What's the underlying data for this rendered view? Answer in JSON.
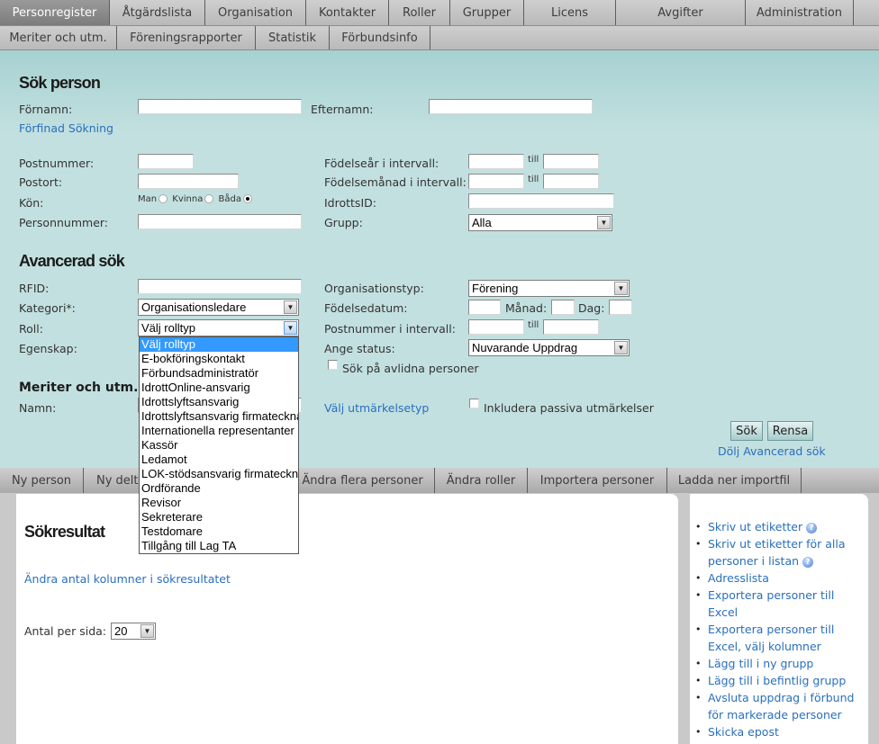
{
  "nav_primary": [
    {
      "label": "Personregister",
      "active": true
    },
    {
      "label": "Åtgärdslista"
    },
    {
      "label": "Organisation"
    },
    {
      "label": "Kontakter"
    },
    {
      "label": "Roller"
    },
    {
      "label": "Grupper"
    },
    {
      "label": "Licens"
    },
    {
      "label": "Avgifter"
    },
    {
      "label": "Administration"
    }
  ],
  "nav_secondary": [
    {
      "label": "Meriter och utm."
    },
    {
      "label": "Föreningsrapporter"
    },
    {
      "label": "Statistik"
    },
    {
      "label": "Förbundsinfo"
    }
  ],
  "search": {
    "title": "Sök person",
    "fornamn_label": "Förnamn:",
    "efternamn_label": "Efternamn:",
    "refine_link": "Förfinad Sökning",
    "postnummer_label": "Postnummer:",
    "postort_label": "Postort:",
    "kon_label": "Kön:",
    "kon_options": [
      "Man",
      "Kvinna",
      "Båda"
    ],
    "kon_selected": "Båda",
    "personnummer_label": "Personnummer:",
    "fodelsear_label": "Födelseår i intervall:",
    "fodelsemanad_label": "Födelsemånad i intervall:",
    "till": "till",
    "idrottsid_label": "IdrottsID:",
    "grupp_label": "Grupp:",
    "grupp_value": "Alla"
  },
  "advanced": {
    "title": "Avancerad sök",
    "rfid_label": "RFID:",
    "kategori_label": "Kategori*:",
    "kategori_value": "Organisationsledare",
    "roll_label": "Roll:",
    "roll_value": "Välj rolltyp",
    "egenskap_label": "Egenskap:",
    "orgtyp_label": "Organisationstyp:",
    "orgtyp_value": "Förening",
    "fodelsedatum_label": "Födelsedatum:",
    "manad_label": "Månad:",
    "dag_label": "Dag:",
    "postnr_intervall_label": "Postnummer i intervall:",
    "status_label": "Ange status:",
    "status_value": "Nuvarande Uppdrag",
    "avlidna_label": "Sök på avlidna personer",
    "meriter_title": "Meriter och utm.",
    "namn_label": "Namn:",
    "utmarkelse_link": "Välj utmärkelsetyp",
    "passiva_label": "Inkludera passiva utmärkelser",
    "search_button": "Sök",
    "reset_button": "Rensa",
    "hide_link": "Dölj Avancerad sök"
  },
  "roll_options": [
    "Välj rolltyp",
    "E-bokföringskontakt",
    "Förbundsadministratör",
    "IdrottOnline-ansvarig",
    "Idrottslyftsansvarig",
    "Idrottslyftsansvarig firmatecknare",
    "Internationella representanter",
    "Kassör",
    "Ledamot",
    "LOK-stödsansvarig firmatecknare",
    "Ordförande",
    "Revisor",
    "Sekreterare",
    "Testdomare",
    "Tillgång till Lag TA"
  ],
  "action_tabs": [
    {
      "label": "Ny person"
    },
    {
      "label": "Ny deltagare"
    },
    {
      "label": "Ändra flera personer"
    },
    {
      "label": "Ändra roller"
    },
    {
      "label": "Importera personer"
    },
    {
      "label": "Ladda ner importfil"
    }
  ],
  "results": {
    "title": "Sökresultat",
    "columns_link": "Ändra antal kolumner i sökresultatet",
    "per_page_label": "Antal per sida:",
    "per_page_value": "20"
  },
  "side_actions": [
    {
      "label": "Skriv ut etiketter",
      "help": true
    },
    {
      "label": "Skriv ut etiketter för alla personer i listan",
      "help": true
    },
    {
      "label": "Adresslista"
    },
    {
      "label": "Exportera personer till Excel"
    },
    {
      "label": "Exportera personer till Excel, välj kolumner"
    },
    {
      "label": "Lägg till i ny grupp"
    },
    {
      "label": "Lägg till i befintlig grupp"
    },
    {
      "label": "Avsluta uppdrag i förbund för markerade personer"
    },
    {
      "label": "Skicka epost"
    }
  ]
}
